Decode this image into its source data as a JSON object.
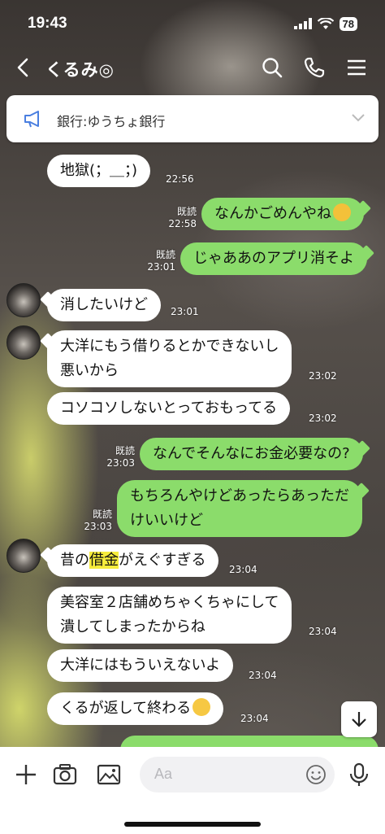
{
  "status_bar": {
    "time": "19:43",
    "battery": "78"
  },
  "header": {
    "title": "くるみ◎"
  },
  "announcement": {
    "text": "銀行:ゆうちょ銀行"
  },
  "messages": [
    {
      "text": "地獄(；＿；)",
      "time": "22:56"
    },
    {
      "text": "なんかごめんやね",
      "read": "既読",
      "time": "22:58"
    },
    {
      "text": "じゃああのアプリ消そよ",
      "read": "既読",
      "time": "23:01"
    },
    {
      "text": "消したいけど",
      "time": "23:01"
    },
    {
      "line1": "大洋にもう借りるとかできないし",
      "line2": "悪いから",
      "time": "23:02"
    },
    {
      "text": "コソコソしないとっておもってる",
      "time": "23:02"
    },
    {
      "text": "なんでそんなにお金必要なの?",
      "read": "既読",
      "time": "23:03"
    },
    {
      "line1": "もちろんやけどあったらあっただ",
      "line2": "けいいけど",
      "read": "既読",
      "time": "23:03"
    },
    {
      "pre": "昔の",
      "highlight": "借金",
      "post": "がえぐすぎる",
      "time": "23:04"
    },
    {
      "line1": "美容室２店舗めちゃくちゃにして",
      "line2": "潰してしまったからね",
      "time": "23:04"
    },
    {
      "text": "大洋にはもういえないよ",
      "time": "23:04"
    },
    {
      "text": "くるが返して終わる",
      "time": "23:04"
    }
  ],
  "input": {
    "placeholder": "Aa"
  },
  "colors": {
    "outgoing_bubble": "#8bdc6b",
    "incoming_bubble": "#ffffff",
    "highlight": "#f6ec3c"
  }
}
